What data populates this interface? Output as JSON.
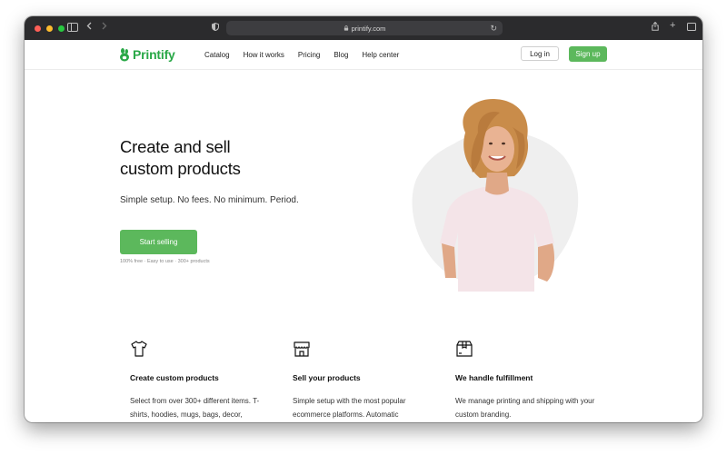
{
  "browser": {
    "url": "printify.com"
  },
  "header": {
    "brand": "Printify",
    "nav": [
      "Catalog",
      "How it works",
      "Pricing",
      "Blog",
      "Help center"
    ],
    "login_label": "Log in",
    "signup_label": "Sign up"
  },
  "hero": {
    "title_line1": "Create and sell",
    "title_line2": "custom products",
    "subtitle": "Simple setup. No fees. No minimum. Period.",
    "cta_label": "Start selling",
    "cta_note": "100% free · Easy to use · 300+ products"
  },
  "features": [
    {
      "icon": "tshirt-icon",
      "title": "Create custom products",
      "text": "Select from over 300+ different items. T-shirts, hoodies, mugs, bags, decor,"
    },
    {
      "icon": "store-icon",
      "title": "Sell your products",
      "text": "Simple setup with the most popular ecommerce platforms. Automatic"
    },
    {
      "icon": "box-icon",
      "title": "We handle fulfillment",
      "text": "We manage printing and shipping with your custom branding."
    }
  ],
  "colors": {
    "brand_green": "#29a847",
    "button_green": "#5cb85c",
    "chrome_dark": "#2b2b2d"
  }
}
